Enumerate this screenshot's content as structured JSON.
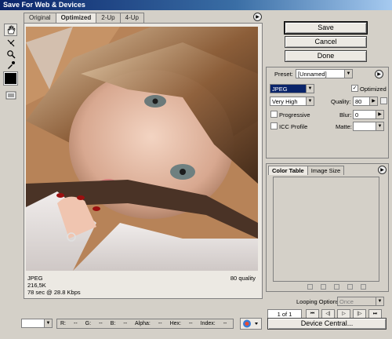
{
  "window": {
    "title": "Save For Web & Devices"
  },
  "tabs": [
    {
      "label": "Original"
    },
    {
      "label": "Optimized",
      "active": true
    },
    {
      "label": "2-Up"
    },
    {
      "label": "4-Up"
    }
  ],
  "tools": [
    "hand-tool-icon",
    "slice-select-icon",
    "zoom-icon",
    "eyedropper-icon"
  ],
  "preview": {
    "format": "JPEG",
    "size": "216,5K",
    "download": "78 sec @ 28.8 Kbps",
    "quality": "80 quality"
  },
  "actions": {
    "save": "Save",
    "cancel": "Cancel",
    "done": "Done"
  },
  "settings": {
    "preset_label": "Preset:",
    "preset_value": "[Unnamed]",
    "format_value": "JPEG",
    "optimized_label": "Optimized",
    "optimized_checked": true,
    "quality_level": "Very High",
    "quality_label": "Quality:",
    "quality_value": "80",
    "progressive_label": "Progressive",
    "progressive_checked": false,
    "blur_label": "Blur:",
    "blur_value": "0",
    "icc_label": "ICC Profile",
    "icc_checked": false,
    "matte_label": "Matte:",
    "matte_value": ""
  },
  "color_table": {
    "tabs": [
      {
        "label": "Color Table",
        "active": true
      },
      {
        "label": "Image Size"
      }
    ]
  },
  "animation": {
    "looping_label": "Looping Options:",
    "looping_value": "Once",
    "frame_counter": "1 of 1",
    "buttons": [
      "⏮",
      "◁|",
      "▷",
      "|▷",
      "⏭"
    ]
  },
  "device_central_label": "Device Central...",
  "status_bar": {
    "zoom_value": "",
    "r": "R:",
    "r_val": "--",
    "g": "G:",
    "g_val": "--",
    "b": "B:",
    "b_val": "--",
    "alpha": "Alpha:",
    "alpha_val": "--",
    "hex": "Hex:",
    "hex_val": "--",
    "index": "Index:",
    "index_val": "--"
  },
  "colors": {
    "titlebar": "#0a246a",
    "highlight": "#0a246a",
    "face_bg": "#d4d0c8"
  }
}
